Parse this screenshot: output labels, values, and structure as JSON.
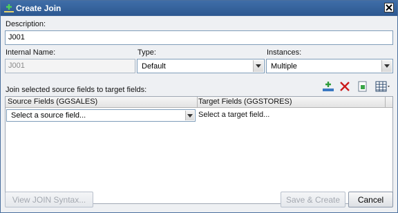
{
  "dialog": {
    "title": "Create Join"
  },
  "form": {
    "description_label": "Description:",
    "description_value": "J001",
    "internal_name_label": "Internal Name:",
    "internal_name_value": "J001",
    "type_label": "Type:",
    "type_value": "Default",
    "instances_label": "Instances:",
    "instances_value": "Multiple",
    "join_instruction": "Join selected source fields to target fields:"
  },
  "grid": {
    "source_header": "Source Fields (GGSALES)",
    "target_header": "Target Fields (GGSTORES)",
    "source_placeholder": "Select a source field...",
    "target_placeholder": "Select a target field..."
  },
  "buttons": {
    "view_syntax": "View JOIN Syntax...",
    "save_create": "Save & Create",
    "cancel": "Cancel"
  },
  "colors": {
    "title_bar": "#2c5890",
    "delete_icon": "#cc1b1b",
    "add_icon": "#2e9b3a"
  }
}
